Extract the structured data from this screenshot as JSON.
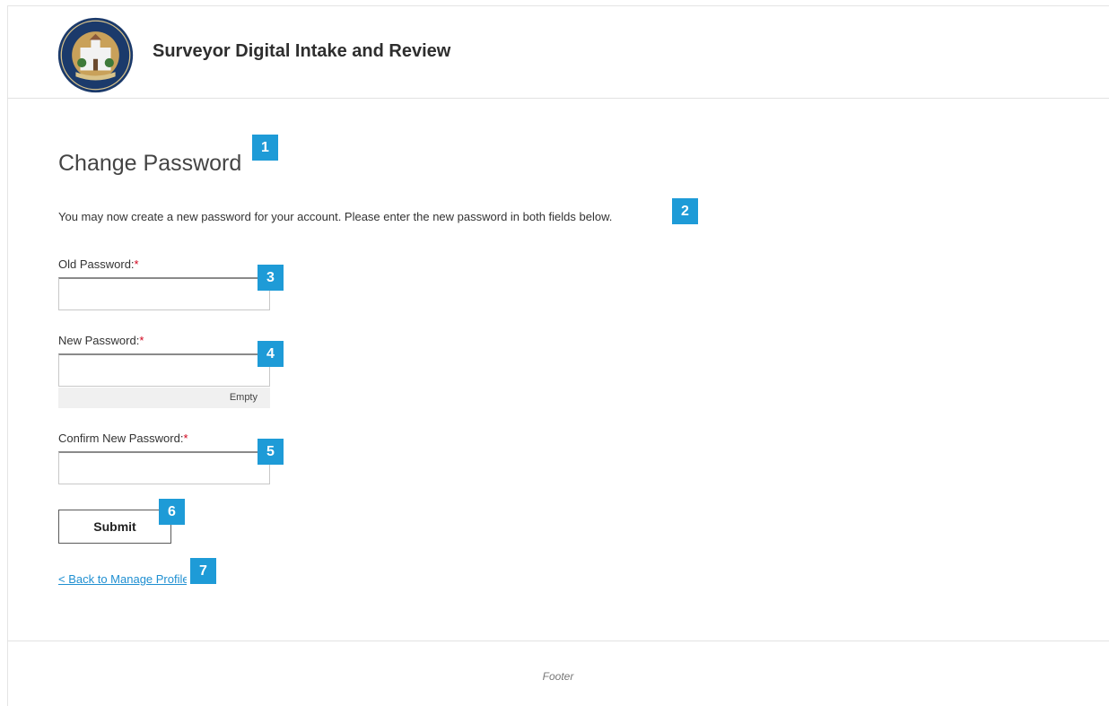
{
  "header": {
    "site_title": "Surveyor Digital Intake and Review",
    "seal": {
      "ring_text": "COUNTY OF SANTA BARBARA",
      "banner_text": "CALIFORNIA"
    }
  },
  "main": {
    "heading": "Change Password",
    "intro": "You may now create a new password for your account. Please enter the new password in both fields below.",
    "fields": [
      {
        "label": "Old Password:",
        "required_mark": "*",
        "value": ""
      },
      {
        "label": "New Password:",
        "required_mark": "*",
        "value": "",
        "strength": "Empty"
      },
      {
        "label": "Confirm New Password:",
        "required_mark": "*",
        "value": ""
      }
    ],
    "submit_label": "Submit",
    "back_link": "< Back to Manage Profile"
  },
  "markers": [
    "1",
    "2",
    "3",
    "4",
    "5",
    "6",
    "7"
  ],
  "footer": {
    "text": "Footer"
  },
  "colors": {
    "accent": "#1e9bd7",
    "link": "#1f8fd1",
    "required": "#d0021b"
  }
}
